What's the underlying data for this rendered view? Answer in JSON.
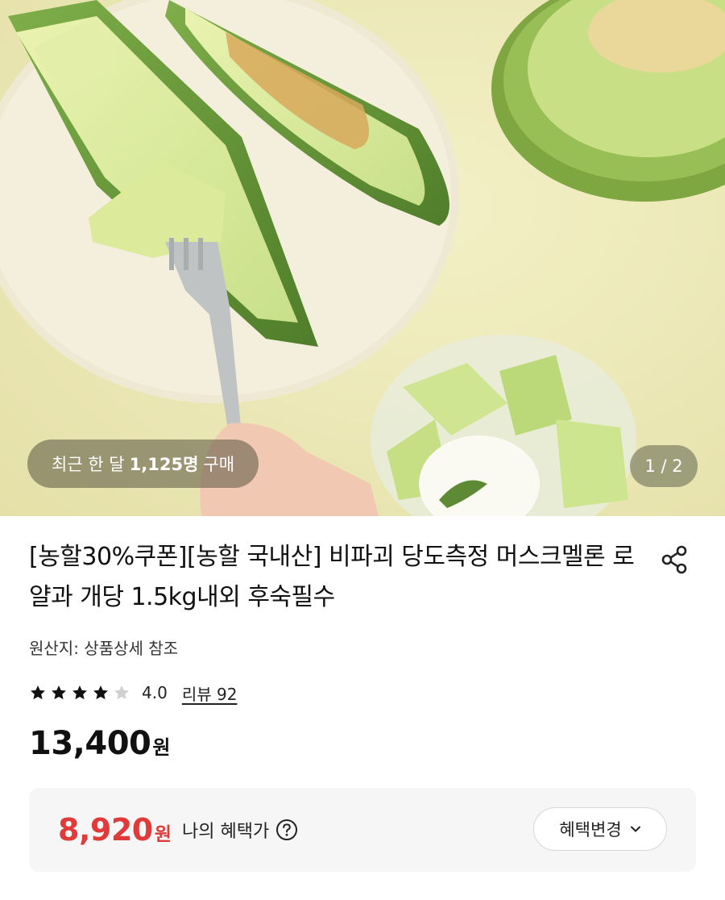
{
  "hero": {
    "recent_prefix": "최근 한 달",
    "recent_count": "1,125명",
    "recent_suffix": "구매",
    "page_indicator": "1 / 2"
  },
  "product": {
    "title": "[농할30%쿠폰][농할 국내산] 비파괴 당도측정 머스크멜론 로얄과 개당 1.5kg내외 후숙필수",
    "origin": "원산지: 상품상세 참조",
    "rating": {
      "value": "4.0",
      "score": 4,
      "max": 5,
      "review_label": "리뷰 92"
    },
    "price": "13,400",
    "price_unit": "원"
  },
  "benefit": {
    "price": "8,920",
    "price_unit": "원",
    "label": "나의 혜택가",
    "change_button": "혜택변경"
  },
  "icons": {
    "share": "share-icon",
    "help": "question-circle-icon",
    "chevron": "chevron-down-icon",
    "star": "star-icon"
  },
  "colors": {
    "benefit_red": "#e03a3a",
    "star_filled": "#111111",
    "star_empty": "#d0d0d0"
  }
}
